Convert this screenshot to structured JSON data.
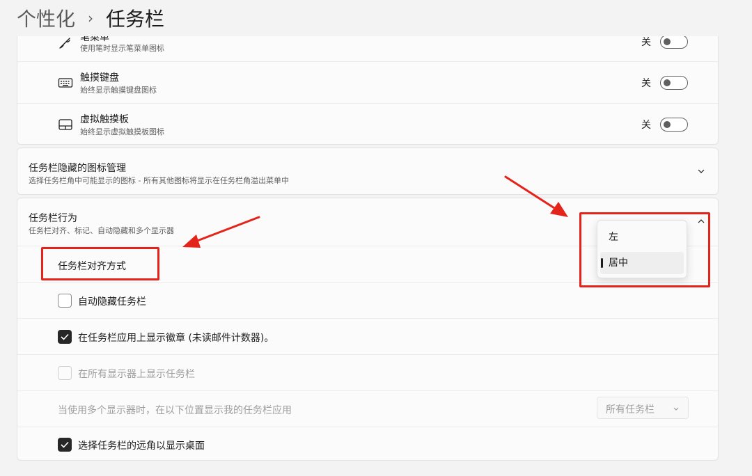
{
  "breadcrumb": {
    "parent": "个性化",
    "separator": "›",
    "current": "任务栏"
  },
  "corner_items": [
    {
      "id": "pen",
      "icon": "pen-icon",
      "title": "笔菜单",
      "subtitle": "使用笔时显示笔菜单图标",
      "state": "关",
      "toggle_on": false
    },
    {
      "id": "touch-keyboard",
      "icon": "keyboard-icon",
      "title": "触摸键盘",
      "subtitle": "始终显示触摸键盘图标",
      "state": "关",
      "toggle_on": false
    },
    {
      "id": "virtual-touchpad",
      "icon": "touchpad-icon",
      "title": "虚拟触摸板",
      "subtitle": "始终显示虚拟触摸板图标",
      "state": "关",
      "toggle_on": false
    }
  ],
  "overflow_section": {
    "title": "任务栏隐藏的图标管理",
    "subtitle": "选择任务栏角中可能显示的图标 - 所有其他图标将显示在任务栏角溢出菜单中",
    "expanded": false
  },
  "behaviors_section": {
    "title": "任务栏行为",
    "subtitle": "任务栏对齐、标记、自动隐藏和多个显示器",
    "expanded": true,
    "alignment_label": "任务栏对齐方式",
    "alignment_options": [
      "左",
      "居中"
    ],
    "alignment_selected": "居中",
    "checkboxes": [
      {
        "label": "自动隐藏任务栏",
        "checked": false,
        "disabled": false
      },
      {
        "label": "在任务栏应用上显示徽章 (未读邮件计数器)。",
        "checked": true,
        "disabled": false
      },
      {
        "label": "在所有显示器上显示任务栏",
        "checked": false,
        "disabled": true
      }
    ],
    "multi_monitor_label": "当使用多个显示器时，在以下位置显示我的任务栏应用",
    "multi_monitor_value": "所有任务栏",
    "far_corner": {
      "label": "选择任务栏的远角以显示桌面",
      "checked": true,
      "disabled": false
    }
  },
  "annotation_color": "#e4241b"
}
